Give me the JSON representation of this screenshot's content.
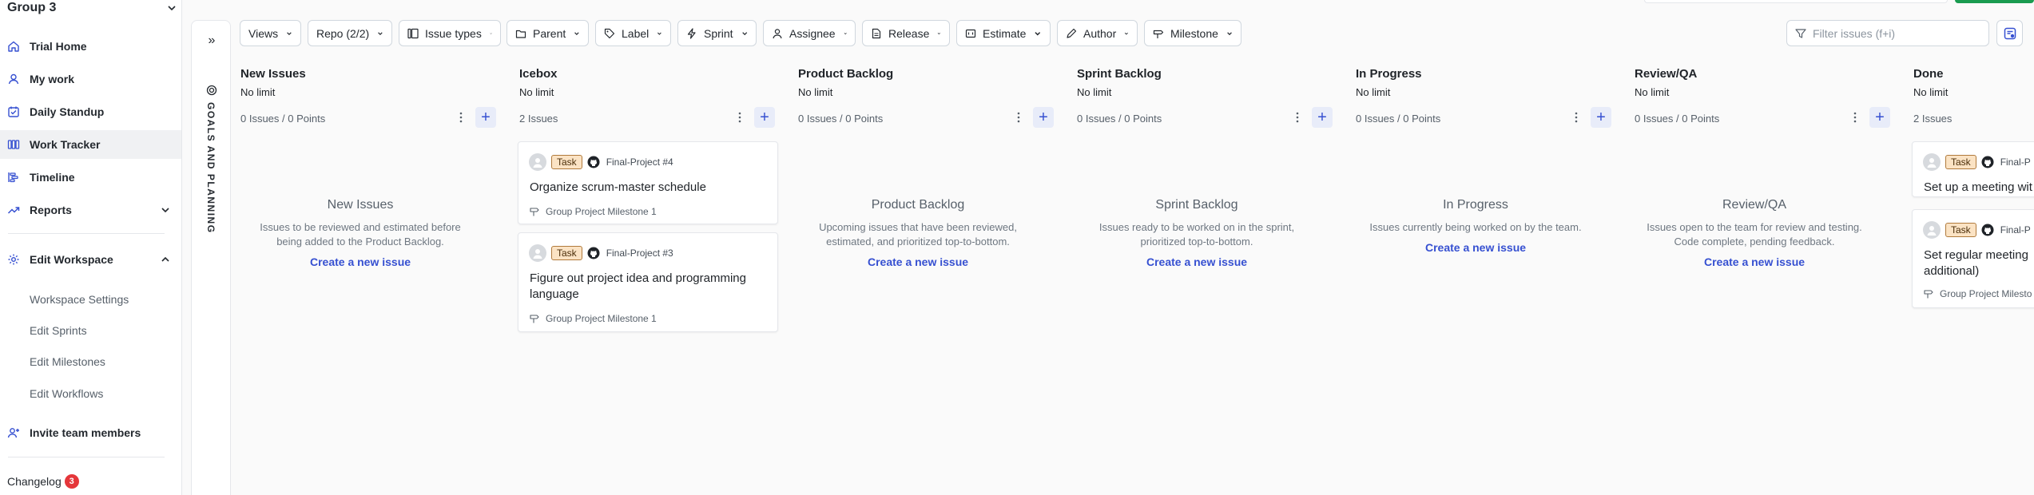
{
  "workspace": {
    "name": "Group 3"
  },
  "sidebar": {
    "items": [
      {
        "label": "Trial Home"
      },
      {
        "label": "My work"
      },
      {
        "label": "Daily Standup"
      },
      {
        "label": "Work Tracker"
      },
      {
        "label": "Timeline"
      },
      {
        "label": "Reports"
      },
      {
        "label": "Edit Workspace"
      }
    ],
    "sub_items": [
      {
        "label": "Workspace Settings"
      },
      {
        "label": "Edit Sprints"
      },
      {
        "label": "Edit Milestones"
      },
      {
        "label": "Edit Workflows"
      }
    ],
    "invite_label": "Invite team members",
    "changelog_label": "Changelog",
    "changelog_count": "3"
  },
  "goals_panel": {
    "label": "GOALS AND PLANNING"
  },
  "filters": [
    {
      "label": "Views"
    },
    {
      "label": "Repo (2/2)"
    },
    {
      "label": "Issue types"
    },
    {
      "label": "Parent"
    },
    {
      "label": "Label"
    },
    {
      "label": "Sprint"
    },
    {
      "label": "Assignee"
    },
    {
      "label": "Release"
    },
    {
      "label": "Estimate"
    },
    {
      "label": "Author"
    },
    {
      "label": "Milestone"
    }
  ],
  "search": {
    "placeholder": "Filter issues (f+i)"
  },
  "columns": [
    {
      "title": "New Issues",
      "limit": "No limit",
      "count": "0 Issues / 0 Points",
      "empty_title": "New Issues",
      "empty_desc": "Issues to be reviewed and estimated before being added to the Product Backlog.",
      "empty_link": "Create a new issue"
    },
    {
      "title": "Icebox",
      "limit": "No limit",
      "count": "2 Issues",
      "cards": [
        {
          "tag": "Task",
          "ref": "Final-Project #4",
          "title": "Organize scrum-master schedule",
          "milestone": "Group Project Milestone 1"
        },
        {
          "tag": "Task",
          "ref": "Final-Project #3",
          "title": "Figure out project idea and programming language",
          "milestone": "Group Project Milestone 1"
        }
      ]
    },
    {
      "title": "Product Backlog",
      "limit": "No limit",
      "count": "0 Issues / 0 Points",
      "empty_title": "Product Backlog",
      "empty_desc": "Upcoming issues that have been reviewed, estimated, and prioritized top-to-bottom.",
      "empty_link": "Create a new issue"
    },
    {
      "title": "Sprint Backlog",
      "limit": "No limit",
      "count": "0 Issues / 0 Points",
      "empty_title": "Sprint Backlog",
      "empty_desc": "Issues ready to be worked on in the sprint, prioritized top-to-bottom.",
      "empty_link": "Create a new issue"
    },
    {
      "title": "In Progress",
      "limit": "No limit",
      "count": "0 Issues / 0 Points",
      "empty_title": "In Progress",
      "empty_desc": "Issues currently being worked on by the team.",
      "empty_link": "Create a new issue"
    },
    {
      "title": "Review/QA",
      "limit": "No limit",
      "count": "0 Issues / 0 Points",
      "empty_title": "Review/QA",
      "empty_desc": "Issues open to the team for review and testing. Code complete, pending feedback.",
      "empty_link": "Create a new issue"
    },
    {
      "title": "Done",
      "limit": "No limit",
      "count": "2 Issues",
      "cards": [
        {
          "tag": "Task",
          "ref": "Final-P",
          "title": "Set up a meeting wit"
        },
        {
          "tag": "Task",
          "ref": "Final-P",
          "title": "Set regular meeting additional)",
          "milestone": "Group Project Milesto"
        }
      ]
    }
  ],
  "colors": {
    "accent": "#3650d1",
    "task_tag_bg": "#fbe3c4",
    "badge": "#e5363a",
    "top_button": "#1a9b50"
  }
}
